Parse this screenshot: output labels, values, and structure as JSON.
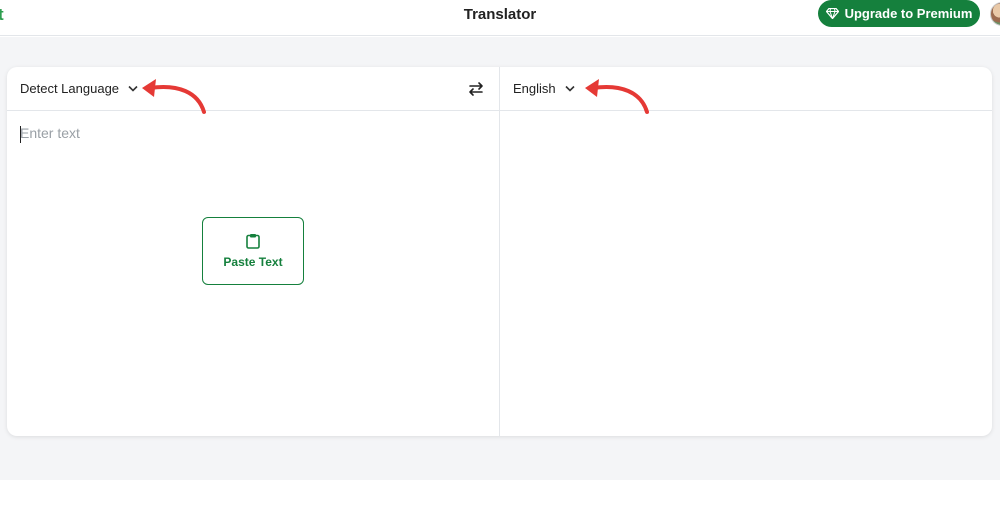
{
  "header": {
    "logo_fragment": "t",
    "title": "Translator",
    "upgrade_label": "Upgrade to Premium"
  },
  "translator": {
    "source_language": "Detect Language",
    "target_language": "English",
    "input_placeholder": "Enter text",
    "paste_label": "Paste Text"
  },
  "colors": {
    "brand_green": "#15803d",
    "annotation_red": "#e53935"
  },
  "icons": [
    "diamond-icon",
    "chevron-down-icon",
    "swap-icon",
    "clipboard-icon",
    "arrow-annotation"
  ]
}
